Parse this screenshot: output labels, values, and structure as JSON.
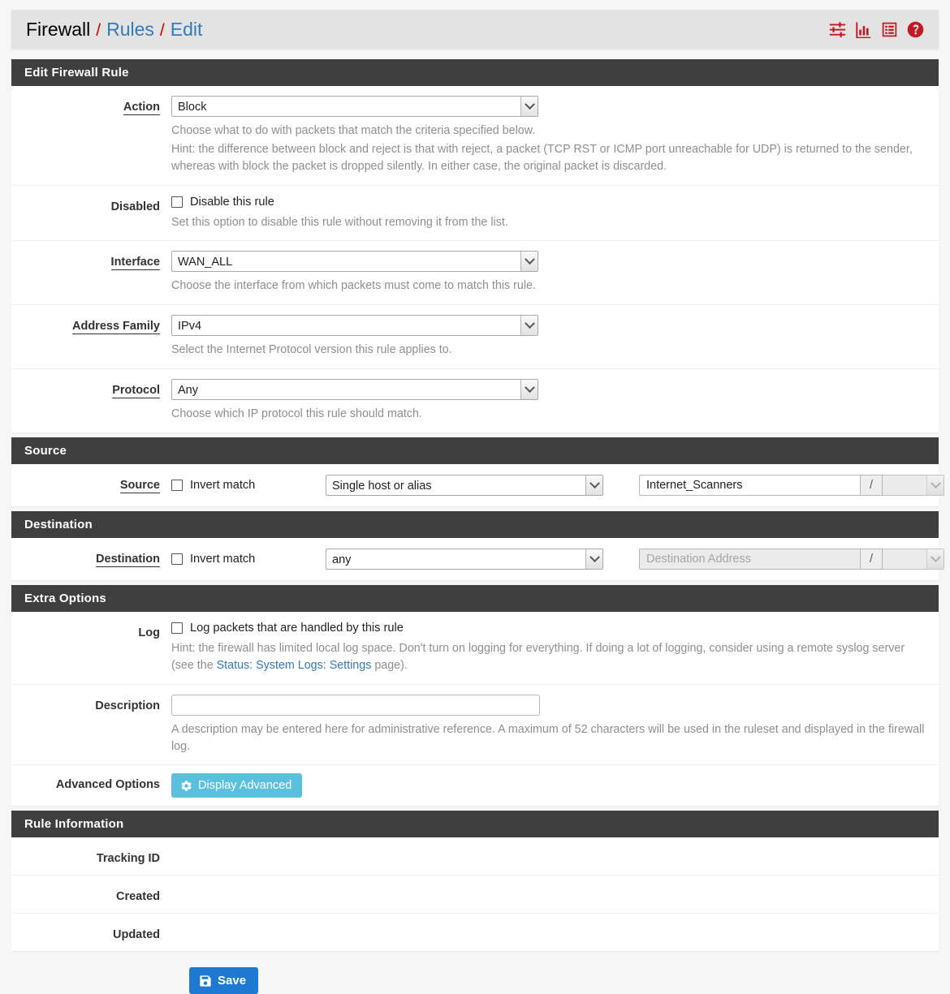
{
  "breadcrumb": {
    "root": "Firewall",
    "section": "Rules",
    "page": "Edit",
    "sep": "/"
  },
  "header_icons": [
    {
      "name": "filter-sliders-icon",
      "title": "Advanced filter"
    },
    {
      "name": "bar-chart-icon",
      "title": "Status monitoring"
    },
    {
      "name": "list-icon",
      "title": "Log"
    },
    {
      "name": "help-icon",
      "title": "Help"
    }
  ],
  "panels": {
    "edit_rule": {
      "title": "Edit Firewall Rule",
      "action": {
        "label": "Action",
        "value": "Block",
        "help_line1": "Choose what to do with packets that match the criteria specified below.",
        "help_line2": "Hint: the difference between block and reject is that with reject, a packet (TCP RST or ICMP port unreachable for UDP) is returned to the sender, whereas with block the packet is dropped silently. In either case, the original packet is discarded."
      },
      "disabled": {
        "label": "Disabled",
        "checkbox_label": "Disable this rule",
        "checked": false,
        "help": "Set this option to disable this rule without removing it from the list."
      },
      "interface": {
        "label": "Interface",
        "value": "WAN_ALL",
        "help": "Choose the interface from which packets must come to match this rule."
      },
      "address_family": {
        "label": "Address Family",
        "value": "IPv4",
        "help": "Select the Internet Protocol version this rule applies to."
      },
      "protocol": {
        "label": "Protocol",
        "value": "Any",
        "help": "Choose which IP protocol this rule should match."
      }
    },
    "source": {
      "title": "Source",
      "label": "Source",
      "invert_label": "Invert match",
      "invert_checked": false,
      "type_value": "Single host or alias",
      "address_value": "Internet_Scanners",
      "address_placeholder": "",
      "slash": "/",
      "mask_value": ""
    },
    "destination": {
      "title": "Destination",
      "label": "Destination",
      "invert_label": "Invert match",
      "invert_checked": false,
      "type_value": "any",
      "address_value": "",
      "address_placeholder": "Destination Address",
      "slash": "/",
      "mask_value": ""
    },
    "extra_options": {
      "title": "Extra Options",
      "log": {
        "label": "Log",
        "checkbox_label": "Log packets that are handled by this rule",
        "checked": false,
        "help_pre": "Hint: the firewall has limited local log space. Don't turn on logging for everything. If doing a lot of logging, consider using a remote syslog server (see the ",
        "help_link": "Status: System Logs: Settings",
        "help_post": " page)."
      },
      "description": {
        "label": "Description",
        "value": "",
        "placeholder": "",
        "help": "A description may be entered here for administrative reference. A maximum of 52 characters will be used in the ruleset and displayed in the firewall log."
      },
      "advanced": {
        "label": "Advanced Options",
        "button_label": "Display Advanced"
      }
    },
    "rule_information": {
      "title": "Rule Information",
      "rows": [
        {
          "label": "Tracking ID",
          "value": ""
        },
        {
          "label": "Created",
          "value": ""
        },
        {
          "label": "Updated",
          "value": ""
        }
      ]
    }
  },
  "footer": {
    "save_label": "Save"
  },
  "colors": {
    "accent_red": "#c01a25",
    "link_blue": "#337ab7",
    "panel_head": "#3f3f3f",
    "btn_info": "#5bc0de",
    "btn_primary": "#1e7ad1"
  }
}
